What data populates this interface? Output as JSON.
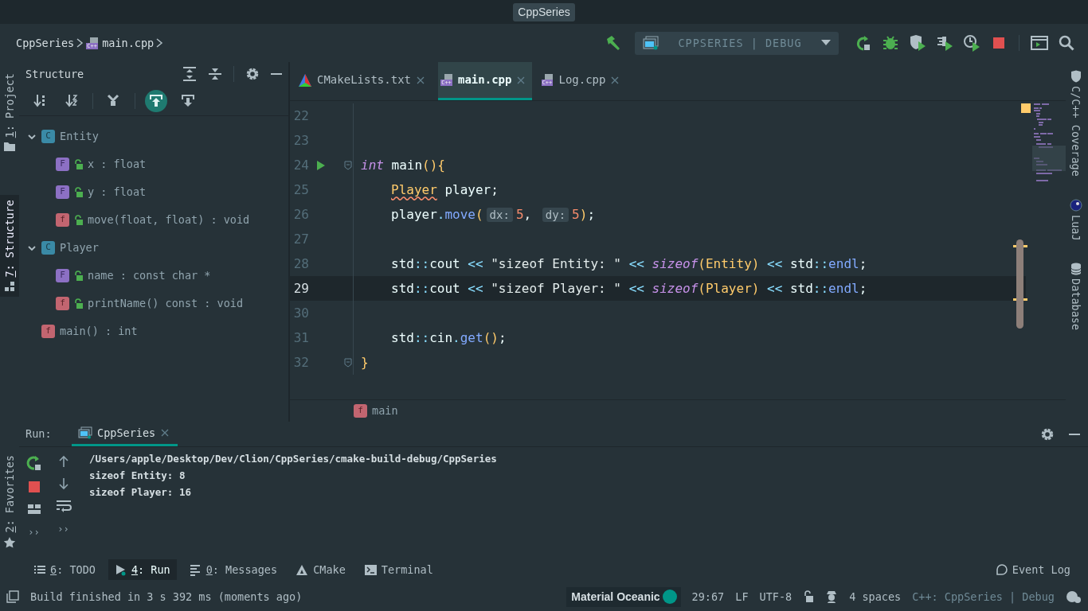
{
  "window": {
    "title": "CppSeries"
  },
  "navbar": {
    "breadcrumb": [
      {
        "kind": "folder",
        "label": "CppSeries"
      },
      {
        "kind": "cpp",
        "badge": "C++",
        "label": "main.cpp"
      }
    ],
    "run_config": "CPPSERIES | DEBUG"
  },
  "left_stripe": {
    "top": [
      {
        "kind": "project",
        "mnemonic": "1",
        "text": ": Project",
        "selected": false
      },
      {
        "kind": "structure",
        "mnemonic": "7",
        "text": ": Structure",
        "selected": true
      }
    ],
    "bottom": [
      {
        "kind": "favorites",
        "mnemonic": "2",
        "text": ": Favorites",
        "selected": false
      }
    ]
  },
  "structure": {
    "title": "Structure",
    "toggles": [
      {
        "kind": "sort-visibility",
        "selected": false
      },
      {
        "kind": "sort-alpha",
        "selected": false
      },
      {
        "kind": "group",
        "selected": false
      },
      {
        "kind": "scroll-to-source",
        "selected": true
      },
      {
        "kind": "scroll-from-source",
        "selected": false
      }
    ],
    "tree": [
      {
        "kind": "class",
        "badge": "C",
        "label": "Entity",
        "expanded": true,
        "children": [
          {
            "kind": "field",
            "badge": "F",
            "label": "x : float",
            "public": true
          },
          {
            "kind": "field",
            "badge": "F",
            "label": "y : float",
            "public": true
          },
          {
            "kind": "method",
            "badge": "f",
            "label": "move(float, float) : void",
            "public": true
          }
        ]
      },
      {
        "kind": "class",
        "badge": "C",
        "label": "Player",
        "expanded": true,
        "children": [
          {
            "kind": "field",
            "badge": "F",
            "label": "name : const char *",
            "public": true
          },
          {
            "kind": "method",
            "badge": "f",
            "label": "printName() const : void",
            "public": true
          }
        ]
      },
      {
        "kind": "function",
        "badge": "f",
        "label": "main() : int",
        "public": false
      }
    ]
  },
  "editor_tabs": [
    {
      "kind": "cmake",
      "label": "CMakeLists.txt",
      "selected": false
    },
    {
      "kind": "cpp",
      "badge": "C++",
      "label": "main.cpp",
      "selected": true
    },
    {
      "kind": "cpp",
      "badge": "C++",
      "label": "Log.cpp",
      "selected": false
    }
  ],
  "code": {
    "lines": [
      {
        "number": "22",
        "current": false,
        "run_marker": false,
        "fold": false
      },
      {
        "number": "23",
        "current": false,
        "run_marker": false,
        "fold": false
      },
      {
        "number": "24",
        "indented": false,
        "current": false,
        "run_marker": true,
        "fold": true,
        "tokens": [
          {
            "kind": "kw",
            "text": "int"
          },
          {
            "kind": "t",
            "text": " main"
          },
          {
            "kind": "p",
            "text": "(){"
          }
        ]
      },
      {
        "number": "25",
        "indented": true,
        "current": false,
        "run_marker": false,
        "fold": false,
        "tokens": [
          {
            "kind": "warn",
            "text": "Player"
          },
          {
            "kind": "t",
            "text": " player;"
          }
        ]
      },
      {
        "number": "26",
        "indented": true,
        "current": false,
        "run_marker": false,
        "fold": false,
        "tokens": [
          {
            "kind": "t",
            "text": "player"
          },
          {
            "kind": "op",
            "text": "."
          },
          {
            "kind": "call",
            "text": "move"
          },
          {
            "kind": "p",
            "text": "("
          },
          {
            "kind": "hint",
            "text": "dx:"
          },
          {
            "kind": "num",
            "text": "5"
          },
          {
            "kind": "t",
            "text": ", "
          },
          {
            "kind": "hint",
            "text": "dy:"
          },
          {
            "kind": "num",
            "text": "5"
          },
          {
            "kind": "p",
            "text": ")"
          },
          {
            "kind": "t",
            "text": ";"
          }
        ]
      },
      {
        "number": "27",
        "current": false,
        "run_marker": false,
        "fold": false
      },
      {
        "number": "28",
        "indented": true,
        "current": false,
        "run_marker": false,
        "fold": false,
        "tokens": [
          {
            "kind": "t",
            "text": "std"
          },
          {
            "kind": "op",
            "text": "::"
          },
          {
            "kind": "t",
            "text": "cout"
          },
          {
            "kind": "op",
            "text": " << "
          },
          {
            "kind": "str",
            "text": "\"sizeof Entity: \""
          },
          {
            "kind": "op",
            "text": " << "
          },
          {
            "kind": "kw",
            "text": "sizeof"
          },
          {
            "kind": "p",
            "text": "("
          },
          {
            "kind": "type",
            "text": "Entity"
          },
          {
            "kind": "p",
            "text": ")"
          },
          {
            "kind": "op",
            "text": " << "
          },
          {
            "kind": "t",
            "text": "std"
          },
          {
            "kind": "op",
            "text": "::"
          },
          {
            "kind": "call",
            "text": "endl"
          },
          {
            "kind": "t",
            "text": ";"
          }
        ]
      },
      {
        "number": "29",
        "indented": true,
        "current": true,
        "run_marker": false,
        "fold": false,
        "tokens": [
          {
            "kind": "t",
            "text": "std"
          },
          {
            "kind": "op",
            "text": "::"
          },
          {
            "kind": "t",
            "text": "cout"
          },
          {
            "kind": "op",
            "text": " << "
          },
          {
            "kind": "str",
            "text": "\"sizeof Player: \""
          },
          {
            "kind": "op",
            "text": " << "
          },
          {
            "kind": "kw",
            "text": "sizeof"
          },
          {
            "kind": "p",
            "text": "("
          },
          {
            "kind": "type",
            "text": "Player"
          },
          {
            "kind": "p",
            "text": ")"
          },
          {
            "kind": "op",
            "text": " << "
          },
          {
            "kind": "t",
            "text": "std"
          },
          {
            "kind": "op",
            "text": "::"
          },
          {
            "kind": "call",
            "text": "endl"
          },
          {
            "kind": "t",
            "text": ";"
          }
        ]
      },
      {
        "number": "30",
        "current": false,
        "run_marker": false,
        "fold": false
      },
      {
        "number": "31",
        "indented": true,
        "current": false,
        "run_marker": false,
        "fold": false,
        "tokens": [
          {
            "kind": "t",
            "text": "std"
          },
          {
            "kind": "op",
            "text": "::"
          },
          {
            "kind": "t",
            "text": "cin"
          },
          {
            "kind": "op",
            "text": "."
          },
          {
            "kind": "call",
            "text": "get"
          },
          {
            "kind": "p",
            "text": "()"
          },
          {
            "kind": "t",
            "text": ";"
          }
        ]
      },
      {
        "number": "32",
        "indented": false,
        "current": false,
        "run_marker": false,
        "fold": true,
        "tokens": [
          {
            "kind": "p",
            "text": "}"
          }
        ]
      }
    ]
  },
  "editor_breadcrumb": {
    "badge": "f",
    "label": "main"
  },
  "right_stripe": [
    {
      "kind": "coverage",
      "label": "C/C++ Coverage"
    },
    {
      "kind": "lua",
      "label": "LuaJ"
    },
    {
      "kind": "database",
      "label": "Database"
    }
  ],
  "run_panel": {
    "label": "Run:",
    "tab": "CppSeries",
    "output": [
      "/Users/apple/Desktop/Dev/Clion/CppSeries/cmake-build-debug/CppSeries",
      "sizeof Entity: 8",
      "sizeof Player: 16"
    ],
    "more": [
      "››",
      "››"
    ]
  },
  "tool_tabs": [
    {
      "kind": "todo",
      "mnemonic": "6",
      "text": ": TODO",
      "selected": false
    },
    {
      "kind": "run",
      "mnemonic": "4",
      "text": ": Run",
      "selected": true
    },
    {
      "kind": "messages",
      "mnemonic": "0",
      "text": ": Messages",
      "selected": false
    },
    {
      "kind": "cmake",
      "text": "CMake",
      "selected": false
    },
    {
      "kind": "terminal",
      "text": "Terminal",
      "selected": false
    }
  ],
  "event_log": "Event Log",
  "status_bar": {
    "message": "Build finished in 3 s 392 ms (moments ago)",
    "theme": "Material Oceanic",
    "position": "29:67",
    "line_separator": "LF",
    "encoding": "UTF-8",
    "indent": "4 spaces",
    "context": "C++: CppSeries | Debug"
  }
}
